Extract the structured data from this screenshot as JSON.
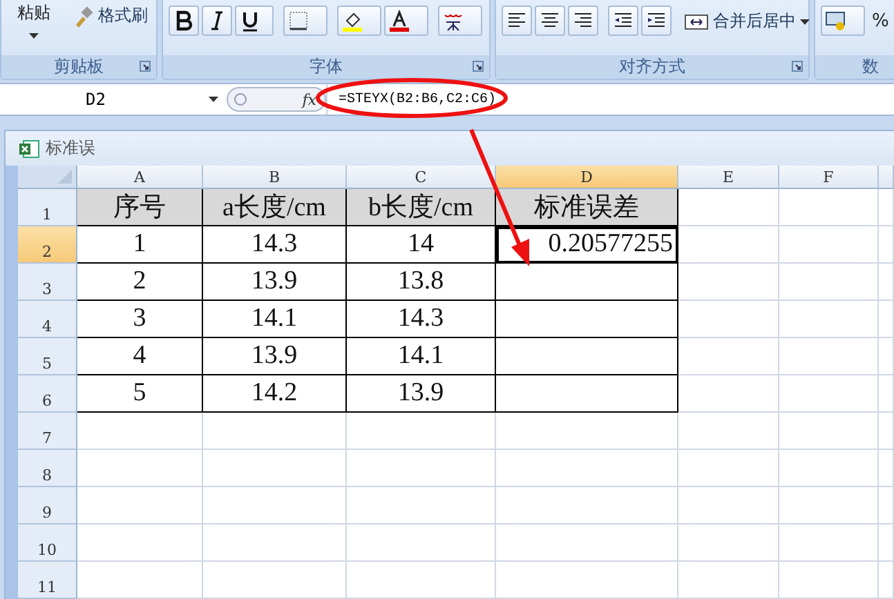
{
  "ribbon": {
    "groups": [
      {
        "kind": "clipboard",
        "label": "剪贴板",
        "paste_label": "粘贴",
        "format_painter": "格式刷"
      },
      {
        "kind": "font",
        "label": "字体"
      },
      {
        "kind": "alignment",
        "label": "对齐方式",
        "merge_label": "合并后居中"
      },
      {
        "kind": "number",
        "label": "数",
        "percent": "%"
      }
    ]
  },
  "formula_bar": {
    "name_box": "D2",
    "fx": "fx",
    "formula": "=STEYX(B2:B6,C2:C6)"
  },
  "workbook": {
    "title": "标准误"
  },
  "sheet": {
    "columns": [
      {
        "label": "A",
        "selected": false
      },
      {
        "label": "B",
        "selected": false
      },
      {
        "label": "C",
        "selected": false
      },
      {
        "label": "D",
        "selected": true
      },
      {
        "label": "E",
        "selected": false
      },
      {
        "label": "F",
        "selected": false
      }
    ],
    "rows": [
      {
        "label": "1",
        "selected": false,
        "kind": "header",
        "cells": [
          {
            "text": "序号",
            "selected": false
          },
          {
            "text": "a长度/cm",
            "selected": false
          },
          {
            "text": "b长度/cm",
            "selected": false
          },
          {
            "text": "标准误差",
            "selected": false
          }
        ]
      },
      {
        "label": "2",
        "selected": true,
        "kind": "data",
        "cells": [
          {
            "text": "1",
            "selected": false
          },
          {
            "text": "14.3",
            "selected": false
          },
          {
            "text": "14",
            "selected": false
          },
          {
            "text": "0.20577255",
            "selected": true
          }
        ]
      },
      {
        "label": "3",
        "selected": false,
        "kind": "data",
        "cells": [
          {
            "text": "2",
            "selected": false
          },
          {
            "text": "13.9",
            "selected": false
          },
          {
            "text": "13.8",
            "selected": false
          },
          {
            "selected": false
          }
        ]
      },
      {
        "label": "4",
        "selected": false,
        "kind": "data",
        "cells": [
          {
            "text": "3",
            "selected": false
          },
          {
            "text": "14.1",
            "selected": false
          },
          {
            "text": "14.3",
            "selected": false
          },
          {
            "selected": false
          }
        ]
      },
      {
        "label": "5",
        "selected": false,
        "kind": "data",
        "cells": [
          {
            "text": "4",
            "selected": false
          },
          {
            "text": "13.9",
            "selected": false
          },
          {
            "text": "14.1",
            "selected": false
          },
          {
            "selected": false
          }
        ]
      },
      {
        "label": "6",
        "selected": false,
        "kind": "data",
        "cells": [
          {
            "text": "5",
            "selected": false
          },
          {
            "text": "14.2",
            "selected": false
          },
          {
            "text": "13.9",
            "selected": false
          },
          {
            "selected": false
          }
        ]
      },
      {
        "label": "7",
        "selected": false,
        "kind": "empty"
      },
      {
        "label": "8",
        "selected": false,
        "kind": "empty"
      },
      {
        "label": "9",
        "selected": false,
        "kind": "empty"
      },
      {
        "label": "10",
        "selected": false,
        "kind": "empty"
      },
      {
        "label": "11",
        "selected": false,
        "kind": "empty"
      }
    ]
  }
}
